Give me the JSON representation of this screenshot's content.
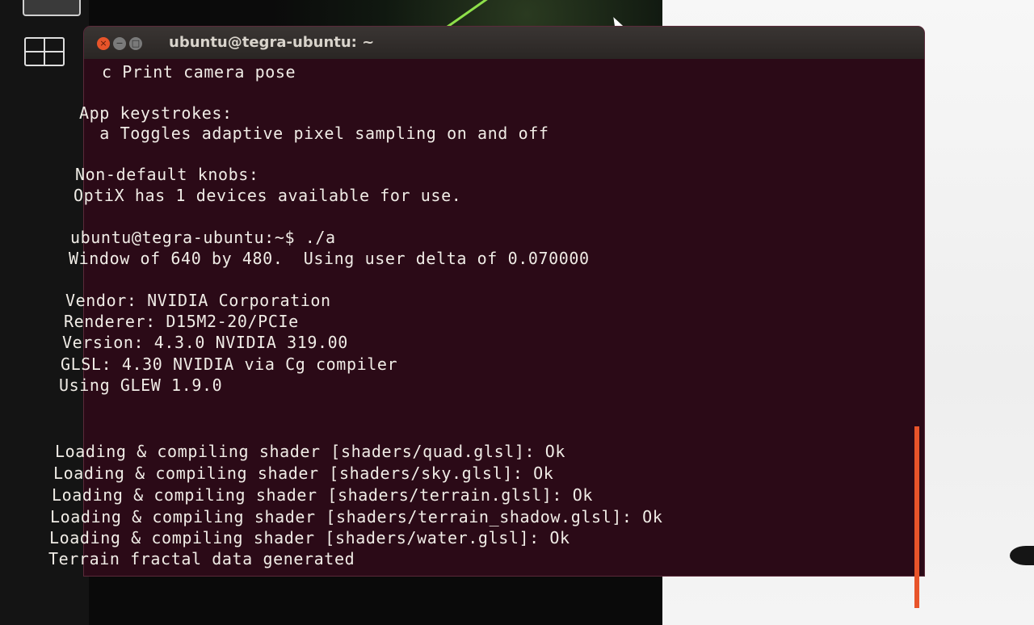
{
  "window": {
    "title": "ubuntu@tegra-ubuntu: ~"
  },
  "controls": {
    "close_glyph": "×",
    "minimize_glyph": "−",
    "maximize_glyph": "□"
  },
  "terminal": {
    "lines": [
      "c Print camera pose",
      "App keystrokes:",
      "  a Toggles adaptive pixel sampling on and off",
      "Non-default knobs:",
      "OptiX has 1 devices available for use.",
      "ubuntu@tegra-ubuntu:~$ ./a",
      "Window of 640 by 480.  Using user delta of 0.070000",
      "Vendor: NVIDIA Corporation",
      "Renderer: D15M2-20/PCIe",
      "Version: 4.3.0 NVIDIA 319.00",
      "GLSL: 4.30 NVIDIA via Cg compiler",
      "Using GLEW 1.9.0",
      "Loading & compiling shader [shaders/quad.glsl]: Ok",
      "Loading & compiling shader [shaders/sky.glsl]: Ok",
      "Loading & compiling shader [shaders/terrain.glsl]: Ok",
      "Loading & compiling shader [shaders/terrain_shadow.glsl]: Ok",
      "Loading & compiling shader [shaders/water.glsl]: Ok",
      "Terrain fractal data generated"
    ]
  },
  "icons": {
    "workspace": "workspace-switcher-icon",
    "cursor": "mouse-pointer-icon"
  },
  "colors": {
    "terminal_bg": "#2b0a17",
    "text": "#f0ece6",
    "close_button": "#e8542a"
  }
}
